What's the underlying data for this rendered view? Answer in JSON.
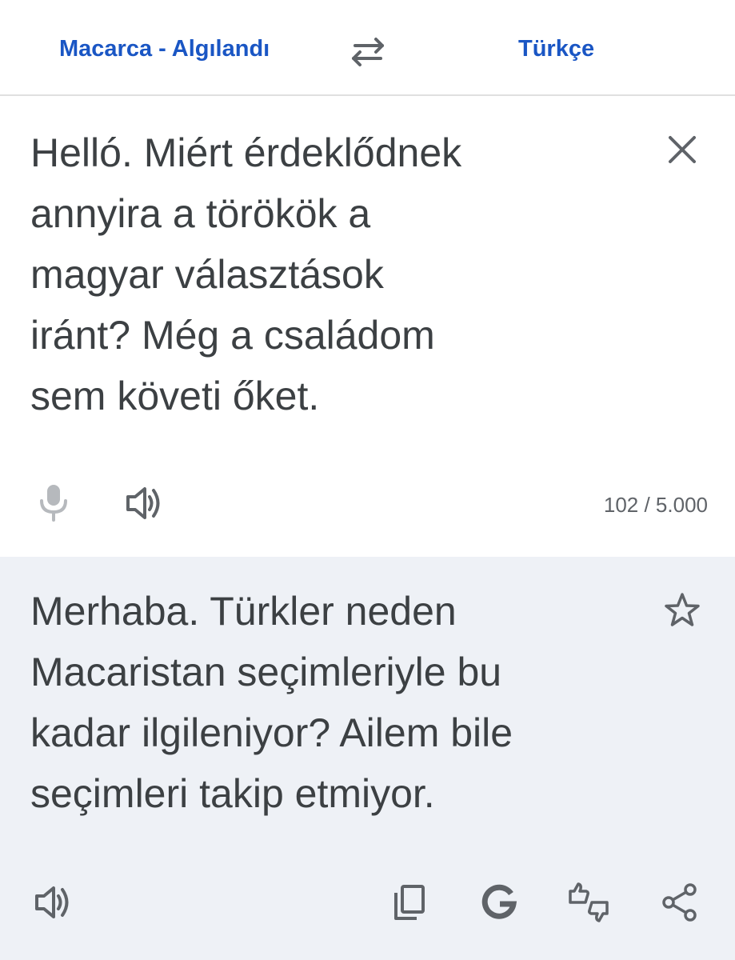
{
  "header": {
    "source_language": "Macarca - Algılandı",
    "target_language": "Türkçe",
    "swap_icon": "swap-arrows-icon"
  },
  "source": {
    "text": "Helló. Miért érdeklődnek\nannyira a törökök a\nmagyar választások\niránt? Még a családom\nsem követi őket.",
    "char_count": "102 / 5.000",
    "icons": [
      "clear-icon",
      "microphone-icon",
      "speaker-icon"
    ]
  },
  "translation": {
    "text": "Merhaba. Türkler neden\nMacaristan seçimleriyle bu\nkadar ilgileniyor? Ailem bile\nseçimleri takip etmiyor.",
    "icons": [
      "star-icon",
      "speaker-icon",
      "copy-icon",
      "google-icon",
      "feedback-icon",
      "share-icon"
    ]
  },
  "colors": {
    "accent": "#1a56c4",
    "text": "#3c4043",
    "icon": "#5f6368",
    "icon_disabled": "#b6b9bd",
    "translation_bg": "#eef1f6",
    "divider": "#e0e0e0"
  }
}
